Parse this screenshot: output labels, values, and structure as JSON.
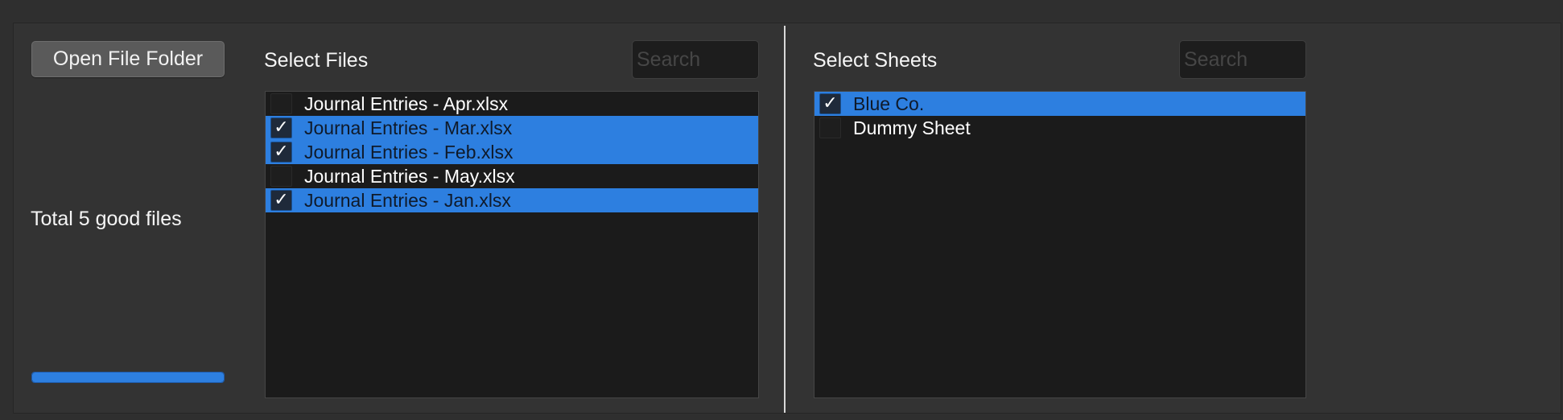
{
  "left_panel": {
    "open_button_label": "Open File Folder",
    "total_label": "Total 5 good files",
    "progress": 1.0
  },
  "files": {
    "title": "Select Files",
    "search_placeholder": "Search",
    "items": [
      {
        "label": "Journal Entries - Apr.xlsx",
        "checked": false,
        "check": ""
      },
      {
        "label": "Journal Entries - Mar.xlsx",
        "checked": true,
        "check": "✓"
      },
      {
        "label": "Journal Entries - Feb.xlsx",
        "checked": true,
        "check": "✓"
      },
      {
        "label": "Journal Entries - May.xlsx",
        "checked": false,
        "check": ""
      },
      {
        "label": "Journal Entries - Jan.xlsx",
        "checked": true,
        "check": "✓"
      }
    ]
  },
  "sheets": {
    "title": "Select Sheets",
    "search_placeholder": "Search",
    "items": [
      {
        "label": "Blue Co.",
        "checked": true,
        "check": "✓"
      },
      {
        "label": "Dummy Sheet",
        "checked": false,
        "check": ""
      }
    ]
  },
  "colors": {
    "selection": "#2d7fe0",
    "list_background": "#1b1b1b",
    "window_background": "#333333"
  }
}
